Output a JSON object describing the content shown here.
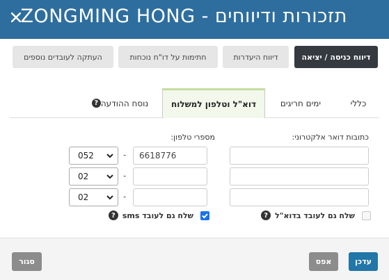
{
  "window": {
    "title": "תזכורות ודיווחים - ZONGMING HONG"
  },
  "toolbar": {
    "entry_exit": "דיווח כניסה / יציאה",
    "absence": "דיווח היעדרות",
    "signatures": "חתימות על דו\"ח נוכחות",
    "copy_employees": "העתקה לעובדים נוספים"
  },
  "tabs": {
    "general": "כללי",
    "special_days": "ימים חריגים",
    "email_phone": "דוא\"ל וטלפון למשלוח",
    "message_text": "נוסח ההודעה"
  },
  "form": {
    "email_label": "כתובות דואר אלקטרוני:",
    "phone_label": "מספרי טלפון:",
    "emails": [
      "",
      "",
      ""
    ],
    "phones": [
      {
        "prefix": "052",
        "number": "6618776"
      },
      {
        "prefix": "02",
        "number": ""
      },
      {
        "prefix": "02",
        "number": ""
      }
    ],
    "separator": "-",
    "send_email_label": "שלח גם לעובד בדוא\"ל",
    "send_email_checked": false,
    "send_sms_label": "שלח גם לעובד sms",
    "send_sms_checked": true
  },
  "footer": {
    "update": "עדכן",
    "reset": "אפס",
    "close": "סגור"
  },
  "colors": {
    "titlebar": "#2e6e9e",
    "dark_button": "#343a40",
    "update_button": "#2276a8",
    "grey_button": "#8c8c8c",
    "active_tab_bg": "#f2f8ec",
    "checkbox_blue": "#1a73e8"
  },
  "icons": {
    "close": "close-icon",
    "help": "question-circle-icon",
    "dropdown": "chevron-down-icon",
    "check": "check-icon"
  }
}
